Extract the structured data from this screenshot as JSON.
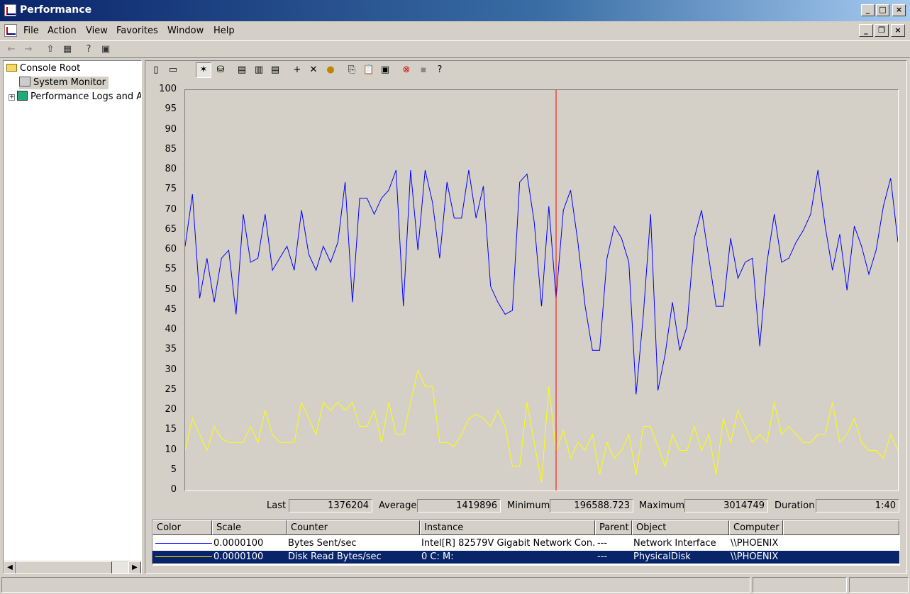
{
  "window": {
    "title": "Performance"
  },
  "menu": [
    "File",
    "Action",
    "View",
    "Favorites",
    "Window",
    "Help"
  ],
  "tree": {
    "root": "Console Root",
    "items": [
      "System Monitor",
      "Performance Logs and A"
    ]
  },
  "stats": {
    "last_label": "Last",
    "last": "1376204",
    "avg_label": "Average",
    "avg": "1419896",
    "min_label": "Minimum",
    "min": "196588.723",
    "max_label": "Maximum",
    "max": "3014749",
    "dur_label": "Duration",
    "dur": "1:40"
  },
  "legend": {
    "headers": [
      "Color",
      "Scale",
      "Counter",
      "Instance",
      "Parent",
      "Object",
      "Computer"
    ],
    "rows": [
      {
        "scale": "0.0000100",
        "counter": "Bytes Sent/sec",
        "instance": "Intel[R] 82579V Gigabit Network Con...",
        "parent": "---",
        "object": "Network Interface",
        "computer": "\\\\PHOENIX",
        "color": "#0000ff"
      },
      {
        "scale": "0.0000100",
        "counter": "Disk Read Bytes/sec",
        "instance": "0 C: M:",
        "parent": "---",
        "object": "PhysicalDisk",
        "computer": "\\\\PHOENIX",
        "color": "#ffff00"
      }
    ]
  },
  "chart_data": {
    "type": "line",
    "ylim": [
      0,
      100
    ],
    "yticks": [
      "100",
      "95",
      "90",
      "85",
      "80",
      "75",
      "70",
      "65",
      "60",
      "55",
      "50",
      "45",
      "40",
      "35",
      "30",
      "25",
      "20",
      "15",
      "10",
      "5",
      "0"
    ],
    "grid": false,
    "cursor_x_index": 51,
    "colors": {
      "cursor": "#ff0000",
      "background": "#d4d0c8"
    },
    "series": [
      {
        "name": "Bytes Sent/sec",
        "color": "#0000ff",
        "values": [
          61,
          74,
          48,
          58,
          47,
          58,
          60,
          44,
          69,
          57,
          58,
          69,
          55,
          58,
          61,
          55,
          70,
          59,
          55,
          61,
          57,
          62,
          77,
          47,
          73,
          73,
          69,
          73,
          75,
          80,
          46,
          80,
          60,
          80,
          72,
          58,
          77,
          68,
          68,
          80,
          68,
          76,
          51,
          47,
          44,
          45,
          77,
          79,
          67,
          46,
          71,
          48,
          70,
          75,
          62,
          46,
          35,
          35,
          58,
          66,
          63,
          57,
          24,
          44,
          69,
          25,
          34,
          47,
          35,
          41,
          63,
          70,
          58,
          46,
          46,
          63,
          53,
          57,
          58,
          36,
          57,
          69,
          57,
          58,
          62,
          65,
          69,
          80,
          66,
          55,
          64,
          50,
          66,
          61,
          54,
          60,
          71,
          78,
          62
        ]
      },
      {
        "name": "Disk Read Bytes/sec",
        "color": "#ffff00",
        "values": [
          10,
          18,
          14,
          10,
          16,
          13,
          12,
          12,
          12,
          16,
          12,
          20,
          14,
          12,
          12,
          12,
          22,
          18,
          14,
          22,
          20,
          22,
          20,
          22,
          16,
          16,
          20,
          12,
          22,
          14,
          14,
          22,
          30,
          26,
          26,
          12,
          12,
          11,
          14,
          18,
          19,
          18,
          16,
          20,
          16,
          6,
          6,
          22,
          12,
          2,
          26,
          10,
          15,
          8,
          12,
          10,
          14,
          4,
          12,
          8,
          10,
          14,
          4,
          16,
          16,
          11,
          6,
          14,
          10,
          10,
          16,
          10,
          14,
          4,
          18,
          12,
          20,
          16,
          12,
          14,
          12,
          22,
          14,
          16,
          14,
          12,
          12,
          14,
          14,
          22,
          12,
          14,
          18,
          12,
          10,
          10,
          8,
          14,
          10
        ]
      }
    ]
  }
}
